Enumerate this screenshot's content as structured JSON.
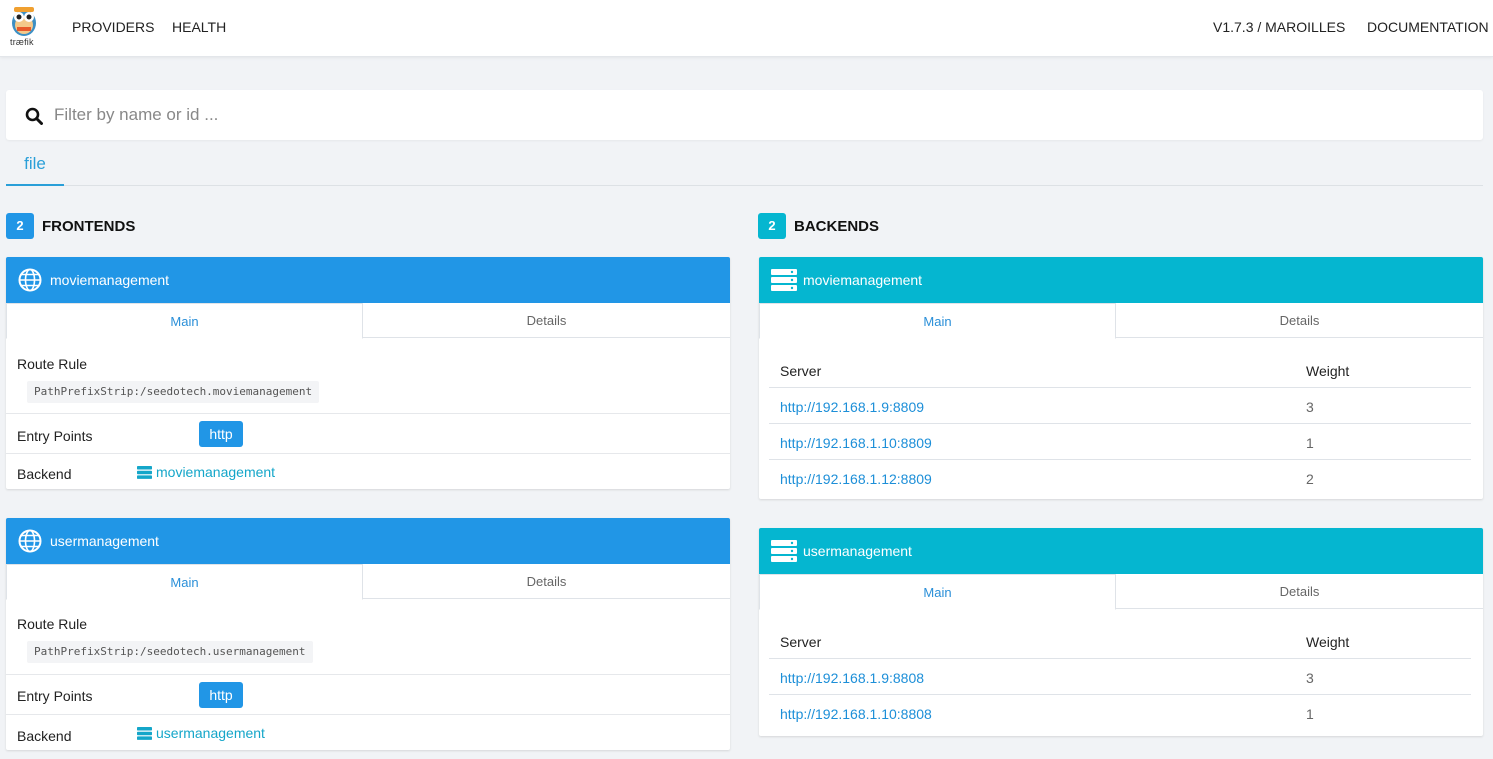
{
  "nav": {
    "logo_text": "træfik",
    "providers": "PROVIDERS",
    "health": "HEALTH",
    "version": "V1.7.3 / MAROILLES",
    "documentation": "DOCUMENTATION"
  },
  "search": {
    "placeholder": "Filter by name or id ..."
  },
  "provider_tabs": [
    "file"
  ],
  "frontends": {
    "count": "2",
    "title": "FRONTENDS",
    "items": [
      {
        "name": "moviemanagement",
        "tab_main": "Main",
        "tab_details": "Details",
        "route_rule_label": "Route Rule",
        "route_rule": "PathPrefixStrip:/seedotech.moviemanagement",
        "entry_points_label": "Entry Points",
        "entry_point": "http",
        "backend_label": "Backend",
        "backend": "moviemanagement"
      },
      {
        "name": "usermanagement",
        "tab_main": "Main",
        "tab_details": "Details",
        "route_rule_label": "Route Rule",
        "route_rule": "PathPrefixStrip:/seedotech.usermanagement",
        "entry_points_label": "Entry Points",
        "entry_point": "http",
        "backend_label": "Backend",
        "backend": "usermanagement"
      }
    ]
  },
  "backends": {
    "count": "2",
    "title": "BACKENDS",
    "items": [
      {
        "name": "moviemanagement",
        "tab_main": "Main",
        "tab_details": "Details",
        "col_server": "Server",
        "col_weight": "Weight",
        "servers": [
          {
            "url": "http://192.168.1.9:8809",
            "weight": "3"
          },
          {
            "url": "http://192.168.1.10:8809",
            "weight": "1"
          },
          {
            "url": "http://192.168.1.12:8809",
            "weight": "2"
          }
        ]
      },
      {
        "name": "usermanagement",
        "tab_main": "Main",
        "tab_details": "Details",
        "col_server": "Server",
        "col_weight": "Weight",
        "servers": [
          {
            "url": "http://192.168.1.9:8808",
            "weight": "3"
          },
          {
            "url": "http://192.168.1.10:8808",
            "weight": "1"
          }
        ]
      }
    ]
  },
  "colors": {
    "frontend_header": "#2196e6",
    "backend_header": "#05b6d0",
    "badge_frontend": "#2196e6",
    "badge_backend": "#05b6d0",
    "link": "#1d8fd8"
  },
  "icons": {
    "frontend": "globe-icon",
    "backend": "server-stack-icon",
    "search": "search-icon",
    "logo": "traefik-gopher-logo"
  }
}
